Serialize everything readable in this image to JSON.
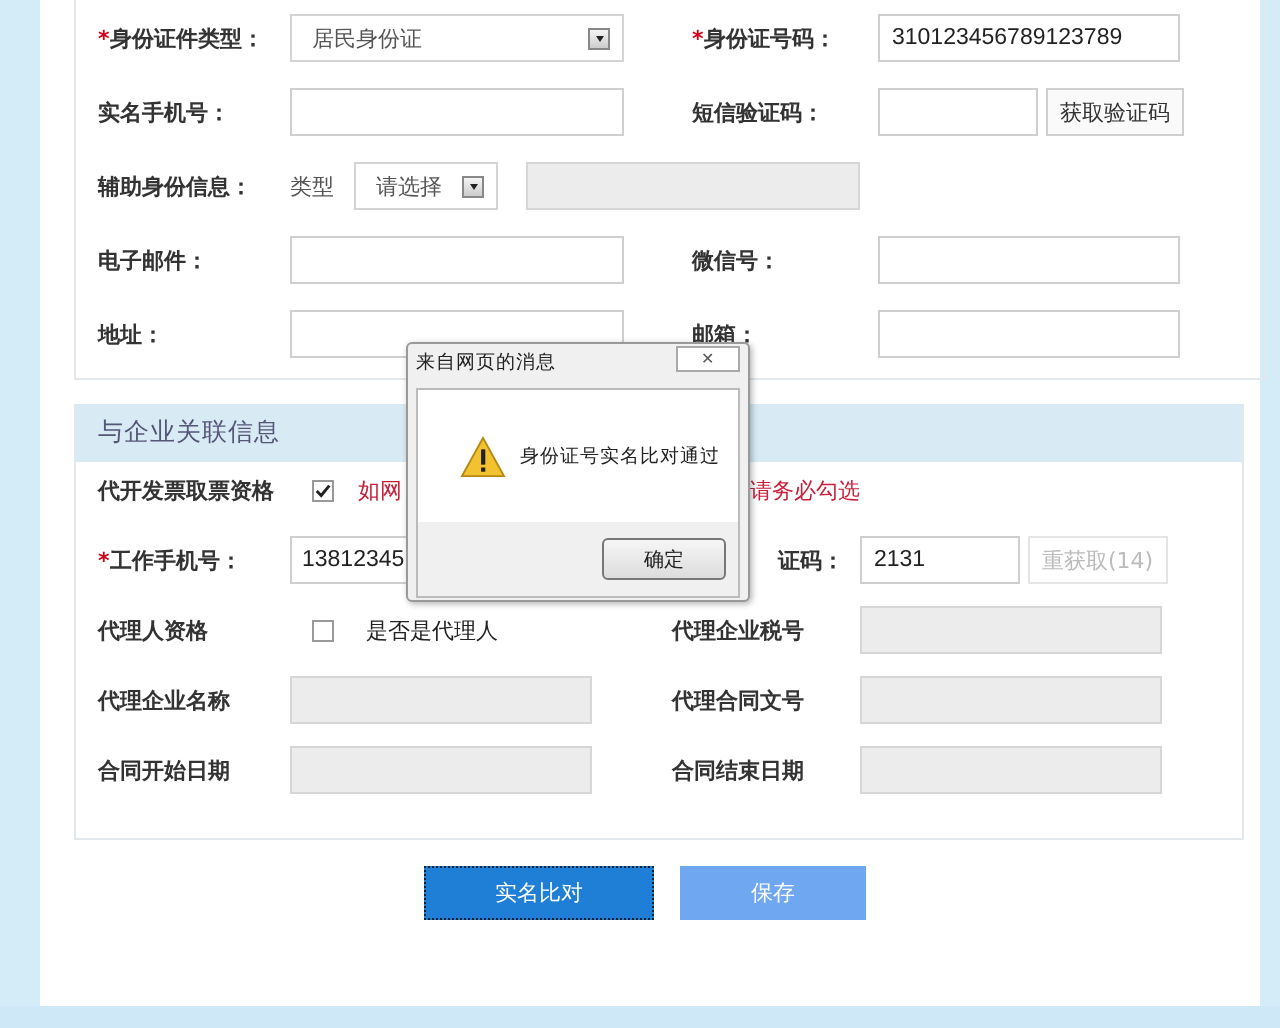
{
  "personal_info": {
    "rows": [
      [
        {
          "label": "身份证件类型：",
          "required_mark": "*",
          "kind": "select",
          "value": "居民身份证"
        },
        {
          "label": "身份证号码：",
          "required_mark": "*",
          "kind": "text",
          "value": "310123456789123789",
          "disabled": false
        }
      ],
      [
        {
          "label": "实名手机号：",
          "kind": "text",
          "disabled": false
        },
        {
          "label": "短信验证码：",
          "kind": "text_button",
          "disabled": false,
          "button": "获取验证码",
          "button_disabled": false
        }
      ],
      [
        {
          "label": "辅助身份信息：",
          "kind": "aux",
          "type_label": "类型",
          "value": "请选择",
          "disabled": true
        }
      ],
      [
        {
          "label": "电子邮件：",
          "kind": "text",
          "disabled": false
        },
        {
          "label": "微信号：",
          "kind": "text",
          "disabled": false
        }
      ],
      [
        {
          "label": "地址：",
          "kind": "text",
          "disabled": false
        },
        {
          "label": "邮箱：",
          "kind": "text",
          "disabled": false
        }
      ]
    ]
  },
  "enterprise_info": {
    "title": "与企业关联信息",
    "rows": [
      [
        {
          "label": "代开发票取票资格",
          "kind": "checkbox_note",
          "checked": true,
          "notes": [
            "如网",
            "请务必勾选"
          ]
        }
      ],
      [
        {
          "label": "工作手机号：",
          "required_mark": "*",
          "kind": "text",
          "value": "13812345",
          "disabled": false
        },
        {
          "label": "证码：",
          "kind": "text_button",
          "value": "2131",
          "disabled": false,
          "button": "重获取(14)",
          "button_disabled": true
        }
      ],
      [
        {
          "label": "代理人资格",
          "kind": "checkbox",
          "checked": false,
          "caption": "是否是代理人"
        },
        {
          "label": "代理企业税号",
          "kind": "text",
          "disabled": true
        }
      ],
      [
        {
          "label": "代理企业名称",
          "kind": "text",
          "disabled": true
        },
        {
          "label": "代理合同文号",
          "kind": "text",
          "disabled": true
        }
      ],
      [
        {
          "label": "合同开始日期",
          "kind": "text",
          "disabled": true
        },
        {
          "label": "合同结束日期",
          "kind": "text",
          "disabled": true
        }
      ]
    ]
  },
  "buttons": [
    {
      "label": "实名比对",
      "kind": "primary",
      "focused": true
    },
    {
      "label": "保存",
      "kind": "secondary",
      "focused": false
    }
  ],
  "dialog": {
    "title": "来自网页的消息",
    "close": "✕",
    "message": "身份证号实名比对通过",
    "ok": "确定"
  }
}
